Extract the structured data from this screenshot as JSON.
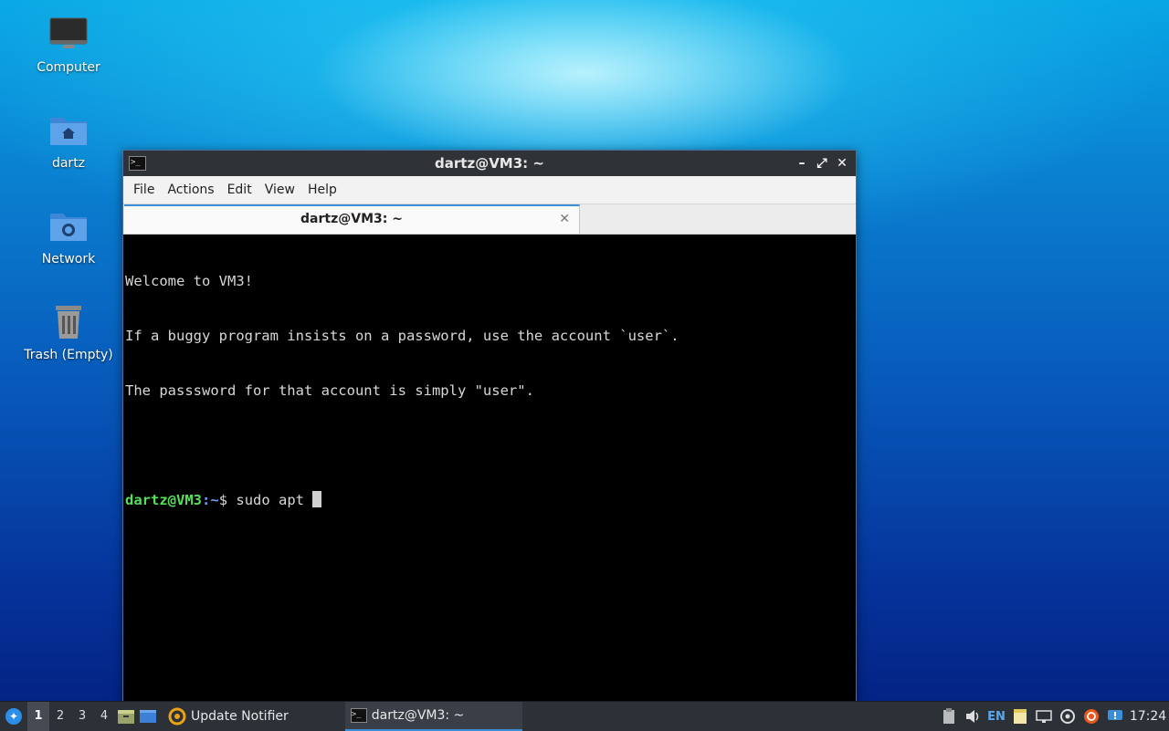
{
  "desktop": {
    "icons": [
      {
        "label": "Computer"
      },
      {
        "label": "dartz"
      },
      {
        "label": "Network"
      },
      {
        "label": "Trash (Empty)"
      }
    ]
  },
  "window": {
    "title": "dartz@VM3: ~",
    "controls": {
      "minimize": "–",
      "maximize": "⤢",
      "close": "✕"
    },
    "menu": [
      "File",
      "Actions",
      "Edit",
      "View",
      "Help"
    ],
    "tab": {
      "label": "dartz@VM3: ~",
      "close": "✕"
    },
    "terminal": {
      "lines": [
        "Welcome to VM3!",
        "If a buggy program insists on a password, use the account `user`.",
        "The passsword for that account is simply \"user\"."
      ],
      "prompt_user": "dartz@VM3",
      "prompt_sep": ":",
      "prompt_path": "~",
      "prompt_dollar": "$ ",
      "command": "sudo apt "
    }
  },
  "taskbar": {
    "workspaces": [
      "1",
      "2",
      "3",
      "4"
    ],
    "tasks": [
      {
        "label": "Update Notifier"
      },
      {
        "label": "dartz@VM3: ~"
      }
    ],
    "tray": {
      "language": "EN",
      "clock": "17:24"
    }
  },
  "colors": {
    "accent": "#3a8fd8",
    "prompt_user": "#55e05a",
    "prompt_path": "#6d9cf0"
  }
}
